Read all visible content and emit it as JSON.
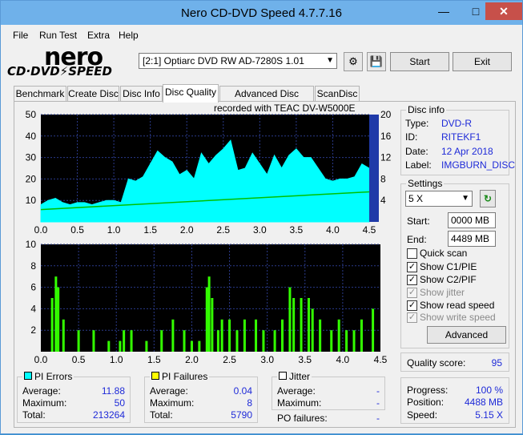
{
  "window": {
    "title": "Nero CD-DVD Speed 4.7.7.16",
    "min": "—",
    "max": "□",
    "close": "✕"
  },
  "menu": [
    "File",
    "Run Test",
    "Extra",
    "Help"
  ],
  "logo": {
    "top": "nero",
    "bottom": "CD·DVD⚡SPEED"
  },
  "toolbar": {
    "drive": "[2:1]  Optiarc DVD RW AD-7280S 1.01",
    "start": "Start",
    "exit": "Exit"
  },
  "tabs": [
    "Benchmark",
    "Create Disc",
    "Disc Info",
    "Disc Quality",
    "Advanced Disc Quality",
    "ScanDisc"
  ],
  "chart_title": "recorded with TEAC     DV-W5000E",
  "disc_info": {
    "legend": "Disc info",
    "rows": [
      {
        "label": "Type:",
        "value": "DVD-R"
      },
      {
        "label": "ID:",
        "value": "RITEKF1"
      },
      {
        "label": "Date:",
        "value": "12 Apr 2018"
      },
      {
        "label": "Label:",
        "value": "IMGBURN_DISC"
      }
    ]
  },
  "settings": {
    "legend": "Settings",
    "speed": "5 X",
    "start_label": "Start:",
    "start_value": "0000 MB",
    "end_label": "End:",
    "end_value": "4489 MB",
    "checks": [
      {
        "label": "Quick scan",
        "checked": false,
        "disabled": false
      },
      {
        "label": "Show C1/PIE",
        "checked": true,
        "disabled": false
      },
      {
        "label": "Show C2/PIF",
        "checked": true,
        "disabled": false
      },
      {
        "label": "Show jitter",
        "checked": true,
        "disabled": true
      },
      {
        "label": "Show read speed",
        "checked": true,
        "disabled": false
      },
      {
        "label": "Show write speed",
        "checked": true,
        "disabled": true
      }
    ],
    "advanced": "Advanced"
  },
  "quality": {
    "label": "Quality score:",
    "value": "95"
  },
  "progress": {
    "rows": [
      {
        "label": "Progress:",
        "value": "100 %"
      },
      {
        "label": "Position:",
        "value": "4488 MB"
      },
      {
        "label": "Speed:",
        "value": "5.15 X"
      }
    ]
  },
  "pi_errors": {
    "legend": "PI Errors",
    "color": "#00ffff",
    "rows": [
      {
        "label": "Average:",
        "value": "11.88"
      },
      {
        "label": "Maximum:",
        "value": "50"
      },
      {
        "label": "Total:",
        "value": "213264"
      }
    ]
  },
  "pi_failures": {
    "legend": "PI Failures",
    "color": "#ffff00",
    "rows": [
      {
        "label": "Average:",
        "value": "0.04"
      },
      {
        "label": "Maximum:",
        "value": "8"
      },
      {
        "label": "Total:",
        "value": "5790"
      }
    ]
  },
  "jitter": {
    "legend": "Jitter",
    "color": "#ffffff",
    "rows": [
      {
        "label": "Average:",
        "value": "-"
      },
      {
        "label": "Maximum:",
        "value": "-"
      }
    ],
    "po_label": "PO failures:",
    "po_value": "-"
  },
  "chart_data": [
    {
      "type": "area",
      "series": [
        {
          "name": "PI Errors",
          "color": "#00ffff",
          "x": [
            0,
            0.1,
            0.2,
            0.3,
            0.4,
            0.5,
            0.6,
            0.7,
            0.8,
            0.9,
            1.0,
            1.1,
            1.2,
            1.3,
            1.4,
            1.5,
            1.6,
            1.7,
            1.8,
            1.9,
            2.0,
            2.1,
            2.2,
            2.3,
            2.4,
            2.5,
            2.6,
            2.7,
            2.8,
            2.9,
            3.0,
            3.1,
            3.2,
            3.3,
            3.4,
            3.5,
            3.6,
            3.7,
            3.8,
            3.9,
            4.0,
            4.1,
            4.2,
            4.3,
            4.4,
            4.5
          ],
          "values": [
            8,
            10,
            11,
            9,
            8,
            9,
            9,
            8,
            9,
            10,
            10,
            9,
            20,
            19,
            21,
            27,
            33,
            30,
            28,
            22,
            24,
            20,
            32,
            27,
            31,
            34,
            38,
            24,
            25,
            32,
            27,
            22,
            31,
            25,
            31,
            34,
            30,
            30,
            25,
            20,
            19,
            20,
            20,
            21,
            27,
            25
          ]
        },
        {
          "name": "read speed",
          "color": "#00c000",
          "x": [
            0,
            4.5
          ],
          "values": [
            2.3,
            5.6
          ]
        }
      ],
      "xlim": [
        0,
        4.5
      ],
      "ylim": [
        0,
        50
      ],
      "y2lim": [
        0,
        20
      ],
      "xticks": [
        "0.0",
        "0.5",
        "1.0",
        "1.5",
        "2.0",
        "2.5",
        "3.0",
        "3.5",
        "4.0",
        "4.5"
      ],
      "yticks": [
        "10",
        "20",
        "30",
        "40",
        "50"
      ],
      "y2ticks": [
        "4",
        "8",
        "12",
        "16",
        "20"
      ]
    },
    {
      "type": "bar",
      "series": [
        {
          "name": "PI Failures",
          "color": "#33ff00",
          "x": [
            0.15,
            0.2,
            0.23,
            0.3,
            0.5,
            0.7,
            0.9,
            1.05,
            1.1,
            1.2,
            1.4,
            1.6,
            1.75,
            1.9,
            2.0,
            2.1,
            2.2,
            2.23,
            2.27,
            2.35,
            2.4,
            2.5,
            2.6,
            2.7,
            2.85,
            2.95,
            3.1,
            3.2,
            3.3,
            3.35,
            3.45,
            3.55,
            3.6,
            3.7,
            3.85,
            3.95,
            4.05,
            4.15,
            4.25,
            4.4
          ],
          "values": [
            5,
            7,
            6,
            3,
            2,
            2,
            1,
            1,
            2,
            2,
            1,
            2,
            3,
            2,
            1,
            1,
            6,
            7,
            5,
            2,
            3,
            3,
            2,
            3,
            3,
            2,
            2,
            3,
            6,
            5,
            5,
            5,
            4,
            3,
            2,
            3,
            2,
            2,
            3,
            4
          ]
        }
      ],
      "xlim": [
        0,
        4.5
      ],
      "ylim": [
        0,
        10
      ],
      "xticks": [
        "0.0",
        "0.5",
        "1.0",
        "1.5",
        "2.0",
        "2.5",
        "3.0",
        "3.5",
        "4.0",
        "4.5"
      ],
      "yticks": [
        "2",
        "4",
        "6",
        "8",
        "10"
      ]
    }
  ]
}
